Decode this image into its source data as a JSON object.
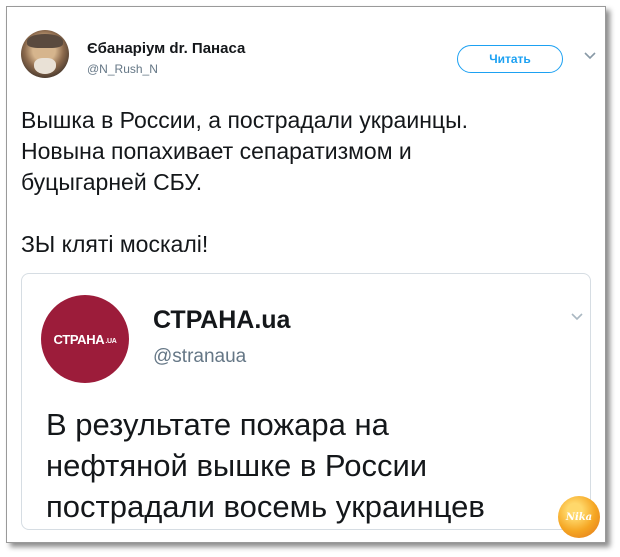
{
  "tweet": {
    "author_name": "Єбанаріум dr. Панаса",
    "author_handle": "@N_Rush_N",
    "follow_label": "Читать",
    "text_lines": [
      "Вышка в России, а пострадали украинцы.",
      "Новына попахивает сепаратизмом и",
      "буцыгарней СБУ."
    ],
    "text_tail": "ЗЫ кляті москалі!"
  },
  "quoted": {
    "logo_text": "СТРАНА",
    "logo_suffix": ".UA",
    "name": "СТРАНА.ua",
    "handle": "@stranaua",
    "text_lines": [
      "В результате пожара на",
      "нефтяной вышке в России",
      "пострадали восемь украинцев"
    ]
  },
  "watermark": {
    "text": "Nika"
  },
  "colors": {
    "accent": "#1da1f2",
    "text": "#14171a",
    "muted": "#657786",
    "logo_bg": "#9c1c3a",
    "border": "#d6dde3"
  },
  "icons": {
    "caret": "chevron-down-icon"
  }
}
